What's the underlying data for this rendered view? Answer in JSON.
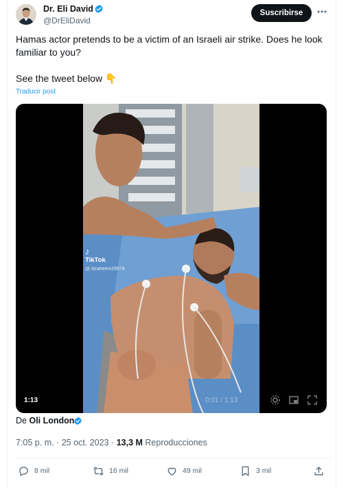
{
  "author": {
    "name": "Dr. Eli David",
    "handle": "@DrEliDavid"
  },
  "subscribe_label": "Suscribirse",
  "tweet": {
    "line1": "Hamas actor pretends to be a victim of an Israeli air strike. Does he look familiar to you?",
    "line2": "See the tweet below 👇"
  },
  "translate_label": "Traducir post",
  "video": {
    "duration": "1:13",
    "watermark_app": "TikTok",
    "watermark_user": "@ ibraheem29979",
    "current_time": "0:01 / 1:13"
  },
  "source": {
    "prefix": "De",
    "name": "Oli London"
  },
  "meta": {
    "time": "7:05 p. m.",
    "separator": "·",
    "date": "25 oct. 2023",
    "views_count": "13,3 M",
    "views_label": "Reproducciones"
  },
  "actions": {
    "replies": "8 mil",
    "reposts": "16 mil",
    "likes": "49 mil",
    "bookmarks": "3 mil"
  },
  "colors": {
    "accent": "#1d9bf0",
    "text": "#0f1419",
    "muted": "#536471"
  }
}
